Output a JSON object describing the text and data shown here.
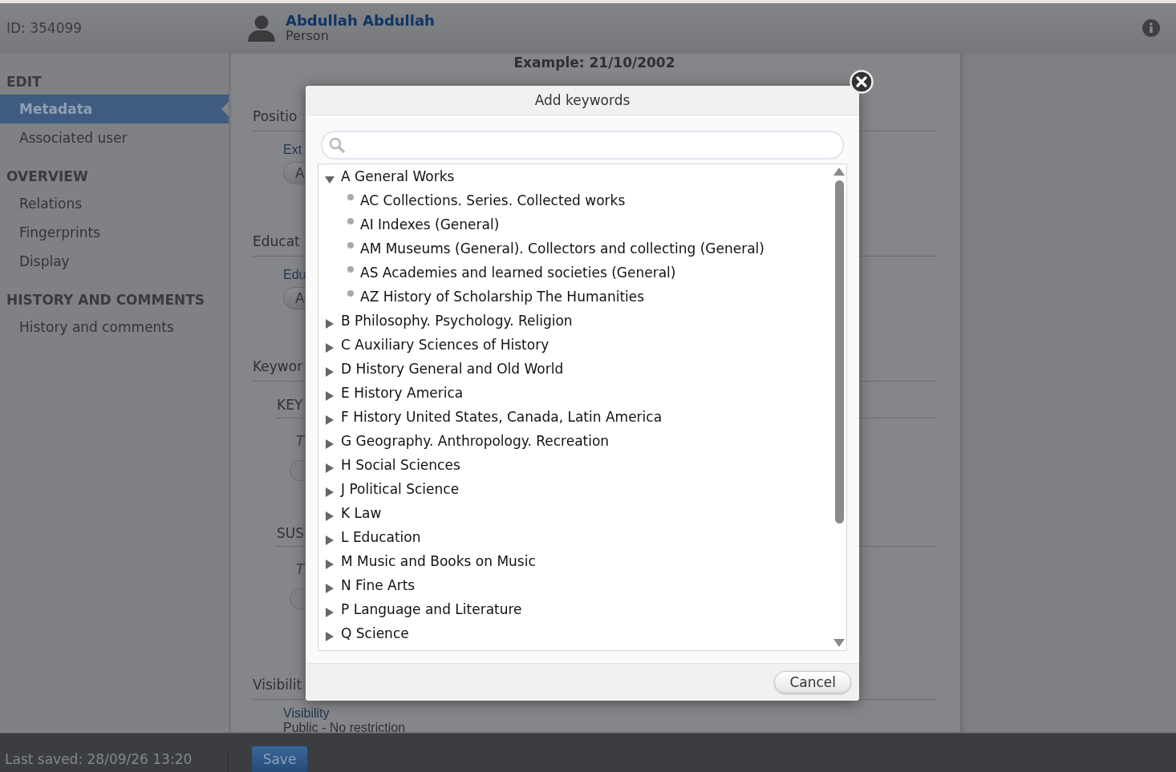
{
  "header": {
    "id": "ID: 354099",
    "name": "Abdullah Abdullah",
    "type": "Person"
  },
  "sidebar": {
    "sections": [
      {
        "title": "EDIT",
        "items": [
          {
            "label": "Metadata",
            "selected": true
          },
          {
            "label": "Associated user",
            "selected": false
          }
        ]
      },
      {
        "title": "OVERVIEW",
        "items": [
          {
            "label": "Relations",
            "selected": false
          },
          {
            "label": "Fingerprints",
            "selected": false
          },
          {
            "label": "Display",
            "selected": false
          }
        ]
      },
      {
        "title": "HISTORY AND COMMENTS",
        "items": [
          {
            "label": "History and comments",
            "selected": false
          }
        ]
      }
    ]
  },
  "form": {
    "example": "Example: 21/10/2002",
    "sections": [
      {
        "title": "Positio",
        "fields": [
          {
            "kind": "labelbutton",
            "label": "Ext",
            "button": "A"
          }
        ]
      },
      {
        "title": "Educat",
        "fields": [
          {
            "kind": "labelbutton",
            "label": "Edu",
            "button": "A"
          }
        ]
      },
      {
        "title": "Keywor",
        "fields": [
          {
            "kind": "group",
            "label": "KEY",
            "hint": "T"
          },
          {
            "kind": "group",
            "label": "SUS",
            "hint": "T"
          }
        ]
      },
      {
        "title": "Visibilit",
        "fields": [
          {
            "kind": "value",
            "label": "Visibility",
            "value": "Public - No restriction"
          }
        ]
      }
    ]
  },
  "dialog": {
    "title": "Add keywords",
    "tree": [
      {
        "label": "A General Works",
        "expanded": true,
        "children": [
          {
            "label": "AC Collections. Series. Collected works"
          },
          {
            "label": "AI Indexes (General)"
          },
          {
            "label": "AM Museums (General). Collectors and collecting (General)"
          },
          {
            "label": "AS Academies and learned societies (General)"
          },
          {
            "label": "AZ History of Scholarship The Humanities"
          }
        ]
      },
      {
        "label": "B Philosophy. Psychology. Religion",
        "expanded": false
      },
      {
        "label": "C Auxiliary Sciences of History",
        "expanded": false
      },
      {
        "label": "D History General and Old World",
        "expanded": false
      },
      {
        "label": "E History America",
        "expanded": false
      },
      {
        "label": "F History United States, Canada, Latin America",
        "expanded": false
      },
      {
        "label": "G Geography. Anthropology. Recreation",
        "expanded": false
      },
      {
        "label": "H Social Sciences",
        "expanded": false
      },
      {
        "label": "J Political Science",
        "expanded": false
      },
      {
        "label": "K Law",
        "expanded": false
      },
      {
        "label": "L Education",
        "expanded": false
      },
      {
        "label": "M Music and Books on Music",
        "expanded": false
      },
      {
        "label": "N Fine Arts",
        "expanded": false
      },
      {
        "label": "P Language and Literature",
        "expanded": false
      },
      {
        "label": "Q Science",
        "expanded": false
      }
    ],
    "cancel": "Cancel"
  },
  "footer": {
    "last_saved": "Last saved: 28/09/26 13:20",
    "save": "Save"
  }
}
